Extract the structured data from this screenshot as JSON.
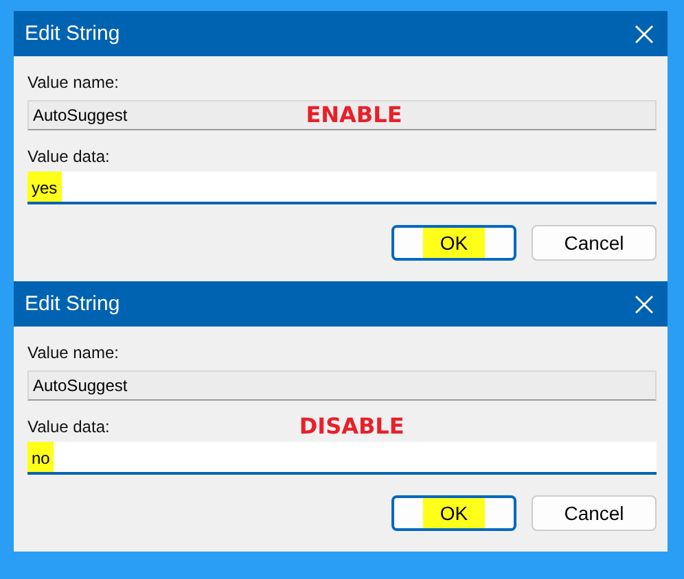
{
  "dialogs": [
    {
      "title": "Edit String",
      "value_name_label": "Value name:",
      "value_name": "AutoSuggest",
      "value_name_annotation": {
        "text": "ENABLE",
        "color": "#e8202a"
      },
      "value_data_label": "Value data:",
      "value_data": "yes",
      "value_data_highlighted": true,
      "buttons": [
        {
          "label": "OK",
          "default": true,
          "highlighted": true
        },
        {
          "label": "Cancel",
          "default": false,
          "highlighted": false
        }
      ]
    },
    {
      "title": "Edit String",
      "value_name_label": "Value name:",
      "value_name": "AutoSuggest",
      "value_data_label": "Value data:",
      "value_data_annotation": {
        "text": "DISABLE",
        "color": "#e8202a"
      },
      "value_data": "no",
      "value_data_highlighted": true,
      "buttons": [
        {
          "label": "OK",
          "default": true,
          "highlighted": true
        },
        {
          "label": "Cancel",
          "default": false,
          "highlighted": false
        }
      ]
    }
  ]
}
